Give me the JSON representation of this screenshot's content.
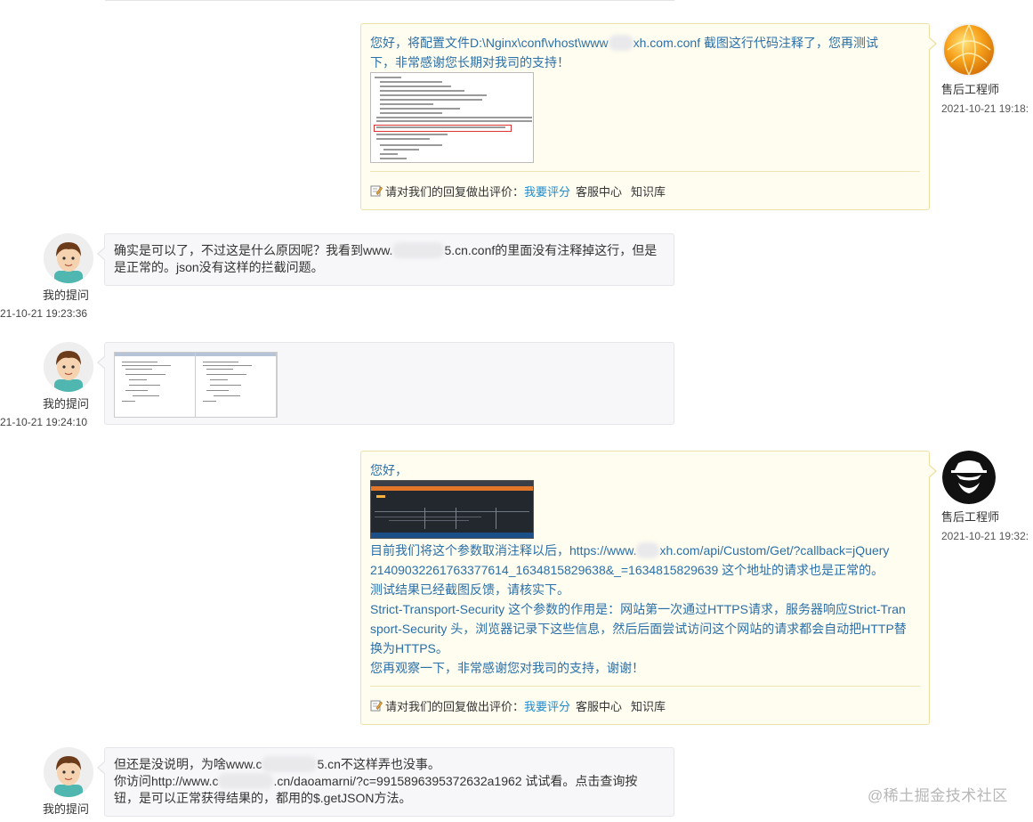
{
  "messages": {
    "eng1": {
      "line1": "您好，将配置文件D:\\Nginx\\conf\\vhost\\www",
      "line1_tail": "xh.com.conf 截图这行代码注释了，您再测试",
      "line2": "下，非常感谢您长期对我司的支持！",
      "sender": "售后工程师",
      "time": "2021-10-21 19:18:",
      "rating_prompt": "请对我们的回复做出评价：",
      "rating_link": "我要评分",
      "service_link": "客服中心",
      "kb_link": "知识库"
    },
    "usr1": {
      "line1_head": "确实是可以了，不过这是什么原因呢？我看到www.",
      "line1_tail": "5.cn.conf的里面没有注释掉这行，但是",
      "line2": "是正常的。json没有这样的拦截问题。",
      "sender": "我的提问",
      "time": "21-10-21 19:23:36"
    },
    "usr2": {
      "sender": "我的提问",
      "time": "21-10-21 19:24:10"
    },
    "eng2": {
      "greeting": "您好，",
      "p1_head": "目前我们将这个参数取消注释以后，https://www.",
      "p1_tail": "xh.com/api/Custom/Get/?callback=jQuery",
      "p1_line2": "21409032261763377614_1634815829638&_=1634815829639 这个地址的请求也是正常的。",
      "p2": "测试结果已经截图反馈，请核实下。",
      "p3_line1": "Strict-Transport-Security 这个参数的作用是：网站第一次通过HTTPS请求，服务器响应Strict-Tran",
      "p3_line2": "sport-Security 头，浏览器记录下这些信息，然后后面尝试访问这个网站的请求都会自动把HTTP替",
      "p3_line3": "换为HTTPS。",
      "p4": "您再观察一下，非常感谢您对我司的支持，谢谢！",
      "sender": "售后工程师",
      "time": "2021-10-21 19:32:",
      "rating_prompt": "请对我们的回复做出评价：",
      "rating_link": "我要评分",
      "service_link": "客服中心",
      "kb_link": "知识库"
    },
    "usr3": {
      "line1_head": "但还是没说明，为啥www.c",
      "line1_tail": "5.cn不这样弄也没事。",
      "line2_head": "你访问http://www.c",
      "line2_tail": ".cn/daoamarni/?c=9915896395372632a1962 试试看。点击查询按",
      "line3_head": "钮，是可以正常获得结果的，都用的$.getJSON方法。",
      "sender": "我的提问"
    }
  },
  "watermark": "@稀土掘金技术社区",
  "colors": {
    "engineer_text": "#2a6fa8",
    "link": "#1a8bd1",
    "engineer_bubble": "#fffdf0",
    "user_bubble": "#f7f7f9"
  },
  "icons": {
    "rating": "pencil-note-icon",
    "engineer1_avatar": "orange-sphere-avatar",
    "engineer2_avatar": "hat-man-avatar",
    "user_avatar": "cartoon-boy-avatar"
  }
}
